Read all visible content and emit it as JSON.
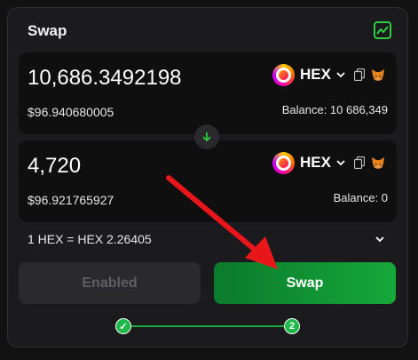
{
  "title": "Swap",
  "icons": {
    "chart": "trending-chart-icon",
    "swap_direction": "arrow-down-icon",
    "copy": "copy-icon",
    "wallet": "metamask-fox-icon"
  },
  "colors": {
    "accent_green": "#1fb84a",
    "background": "#1b1b1d",
    "panel": "#0f0f10"
  },
  "from": {
    "amount": "10,686.3492198",
    "fiat": "$96.940680005",
    "token": "HEX",
    "balance": "Balance: 10 686,349"
  },
  "to": {
    "amount": "4,720",
    "fiat": "$96.921765927",
    "token": "HEX",
    "balance": "Balance: 0"
  },
  "rate": "1 HEX = HEX 2.26405",
  "buttons": {
    "enabled_label": "Enabled",
    "swap_label": "Swap"
  },
  "steps": {
    "one": "✓",
    "two": "2"
  }
}
